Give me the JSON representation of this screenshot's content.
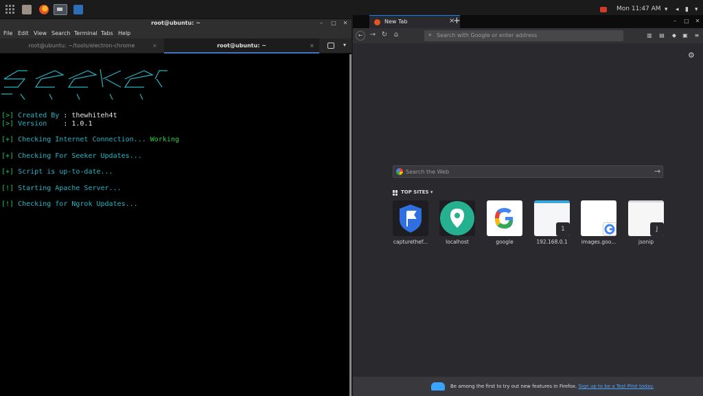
{
  "topbar": {
    "clock": "Mon 11:47 AM"
  },
  "terminal": {
    "window_title": "root@ubuntu: ~",
    "menu": [
      "File",
      "Edit",
      "View",
      "Search",
      "Terminal",
      "Tabs",
      "Help"
    ],
    "tabs": [
      {
        "label": "root@ubuntu: ~/tools/electron-chrome"
      },
      {
        "label": "root@ubuntu: ~"
      }
    ],
    "banner": "   _____ ______ ______ __  __ ______ _____  \n  / ____|  ____|  ____| |/ /|  ____|  __ \\ \n | (___ | |__  | |__  | ' / | |__  | |__) |\n  \\___ \\|  __| |  __| |  <  |  __| |  _  / \n  ____) | |____| |____| . \\ | |____| | \\ \\ \n |_____/|______|______|_|\\_\\|______|_|  \\_\\",
    "lines": [
      {
        "prefix": "[>]",
        "label": "Created By",
        "sep": " : ",
        "value": "thewhiteh4t"
      },
      {
        "prefix": "[>]",
        "label": "Version   ",
        "sep": " : ",
        "value": "1.0.1"
      },
      {
        "prefix": "[+]",
        "text": "Checking Internet Connection... ",
        "status": "Working"
      },
      {
        "prefix": "[+]",
        "text": "Checking For Seeker Updates..."
      },
      {
        "prefix": "[+]",
        "text": "Script is up-to-date..."
      },
      {
        "prefix": "[!]",
        "text": "Starting Apache Server..."
      },
      {
        "prefix": "[!]",
        "text": "Checking for Ngrok Updates..."
      }
    ]
  },
  "browser": {
    "tab_label": "New Tab",
    "url_placeholder": "Search with Google or enter address",
    "web_search_placeholder": "Search the Web",
    "topsites_header": "TOP SITES",
    "topsites": [
      {
        "label": "capturethef...",
        "icon": "shield-flag-icon"
      },
      {
        "label": "localhost",
        "icon": "map-pin-icon"
      },
      {
        "label": "google",
        "icon": "google-g-icon"
      },
      {
        "label": "192.168.0.1",
        "badge": "1"
      },
      {
        "label": "images.goo...",
        "badge_icon": "google-g-icon"
      },
      {
        "label": "jsonip",
        "badge": "J"
      }
    ],
    "footer_text": "Be among the first to try out new features in Firefox. ",
    "footer_link": "Sign up to be a Test Pilot today."
  }
}
